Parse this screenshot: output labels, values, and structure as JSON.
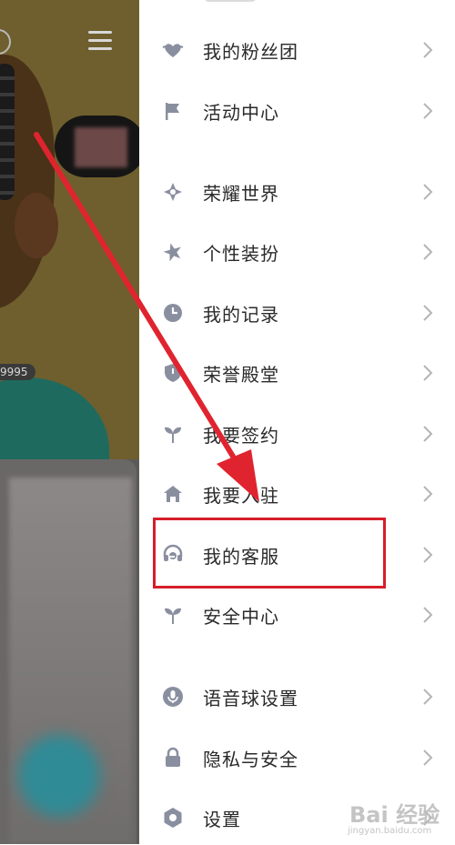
{
  "background": {
    "badge_text": "9995"
  },
  "menu": {
    "items": [
      {
        "label": "我的粉丝团",
        "icon": "heart-icon"
      },
      {
        "label": "活动中心",
        "icon": "flag-icon"
      },
      {
        "label": "荣耀世界",
        "icon": "diamond-star-icon"
      },
      {
        "label": "个性装扮",
        "icon": "star-icon"
      },
      {
        "label": "我的记录",
        "icon": "clock-icon"
      },
      {
        "label": "荣誉殿堂",
        "icon": "shield-icon"
      },
      {
        "label": "我要签约",
        "icon": "sprout-icon"
      },
      {
        "label": "我要入驻",
        "icon": "home-icon"
      },
      {
        "label": "我的客服",
        "icon": "headset-icon"
      },
      {
        "label": "安全中心",
        "icon": "sprout-icon"
      },
      {
        "label": "语音球设置",
        "icon": "microphone-icon"
      },
      {
        "label": "隐私与安全",
        "icon": "lock-icon"
      },
      {
        "label": "设置",
        "icon": "gear-icon"
      }
    ]
  },
  "colors": {
    "icon": "#8a8fa0",
    "label": "#2a2a2a",
    "chevron": "#b5b5b5",
    "annotation_red": "#d61e2a"
  },
  "watermark": {
    "logo_text": "Bai 经验",
    "url_text": "jingyan.baidu.com"
  }
}
